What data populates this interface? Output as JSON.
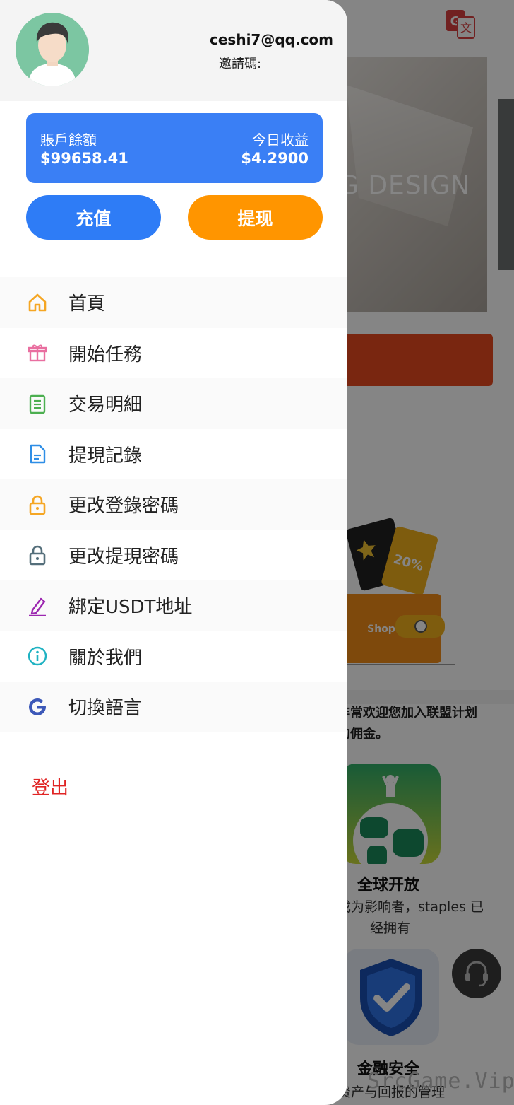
{
  "background": {
    "banner_text": "G DESIGN",
    "intro_line1": "非常欢迎您加入联盟计划",
    "intro_line2": "的佣金。",
    "feature1_title": "全球开放",
    "feature1_desc_line1": "成为影响者，staples 已",
    "feature1_desc_line2": "经拥有",
    "feature2_title": "金融安全",
    "feature2_desc": "资产与回报的管理",
    "illustration_label": "Shop",
    "watermark": "SrcGame.Vip"
  },
  "user": {
    "email": "ceshi7@qq.com",
    "invite_label": "邀請碼:"
  },
  "balance": {
    "account_label": "賬戶餘額",
    "account_value": "$99658.41",
    "today_label": "今日收益",
    "today_value": "$4.2900"
  },
  "actions": {
    "recharge": "充值",
    "withdraw": "提现"
  },
  "menu": [
    {
      "label": "首頁",
      "icon": "home-icon",
      "color": "#f5a623"
    },
    {
      "label": "開始任務",
      "icon": "gift-icon",
      "color": "#e96fa0"
    },
    {
      "label": "交易明細",
      "icon": "clipboard-icon",
      "color": "#4caf50"
    },
    {
      "label": "提現記錄",
      "icon": "document-icon",
      "color": "#2e8ee6"
    },
    {
      "label": "更改登錄密碼",
      "icon": "lock-icon",
      "color": "#f5a623"
    },
    {
      "label": "更改提現密碼",
      "icon": "lock-icon",
      "color": "#546e7a"
    },
    {
      "label": "綁定USDT地址",
      "icon": "pencil-icon",
      "color": "#9c27b0"
    },
    {
      "label": "關於我們",
      "icon": "info-icon",
      "color": "#1fb2c2"
    },
    {
      "label": "切換語言",
      "icon": "google-icon",
      "color": "#3c58b8"
    }
  ],
  "logout": "登出",
  "colors": {
    "balance_card": "#3a7ff5",
    "recharge_button": "#2e7cf6",
    "withdraw_button": "#ff9500",
    "logout_text": "#e02424"
  }
}
